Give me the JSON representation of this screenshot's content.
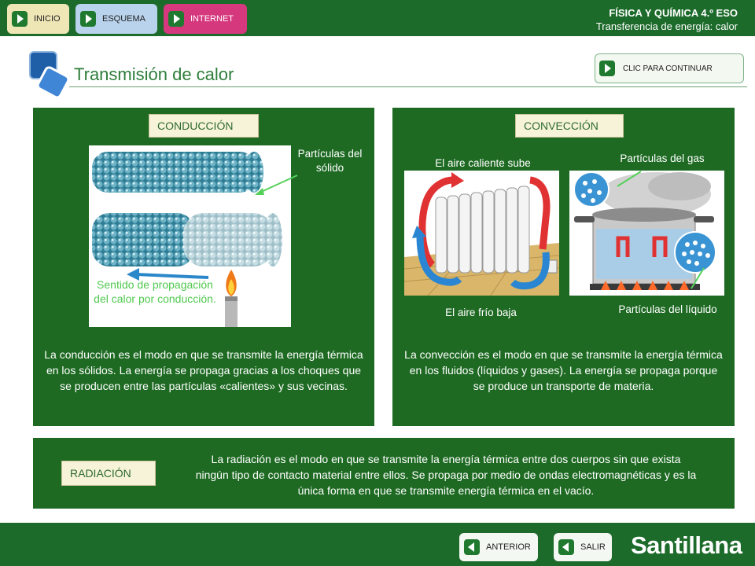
{
  "nav": {
    "inicio": "INICIO",
    "esquema": "ESQUEMA",
    "internet": "INTERNET"
  },
  "header": {
    "subject": "FÍSICA Y QUÍMICA 4.º ESO",
    "topic": "Transferencia de energía: calor"
  },
  "title": "Transmisión de calor",
  "continue_label": "CLIC PARA CONTINUAR",
  "conduccion": {
    "tag": "CONDUCCIÓN",
    "label_particles": "Partículas del sólido",
    "label_direction": "Sentido de propagación del calor por conducción.",
    "text": "La conducción es el modo en que se transmite la energía térmica en los sólidos. La energía se propaga gracias a los choques que se producen entre las partículas «calientes» y sus vecinas."
  },
  "conveccion": {
    "tag": "CONVECCIÓN",
    "label_hot_air": "El aire caliente sube",
    "label_cold_air": "El aire frío baja",
    "label_gas": "Partículas del gas",
    "label_liquid": "Partículas del líquido",
    "text": "La convección es el modo en que se transmite la energía térmica en los fluidos (líquidos y gases). La energía se propaga porque se produce un transporte de materia."
  },
  "radiacion": {
    "tag": "RADIACIÓN",
    "text": "La radiación es el modo en que se transmite la energía térmica entre dos cuerpos sin que exista ningún tipo de contacto material entre ellos. Se propaga por medio de ondas electromagnéticas y es la única forma en que se transmite energía térmica en el vacío."
  },
  "footer": {
    "anterior": "ANTERIOR",
    "salir": "SALIR",
    "brand": "Santillana"
  },
  "colors": {
    "brand_green": "#1d6b2b",
    "panel_green": "#1e6a23",
    "tag_bg": "#f7f3d8",
    "accent_pink": "#d6387e"
  }
}
